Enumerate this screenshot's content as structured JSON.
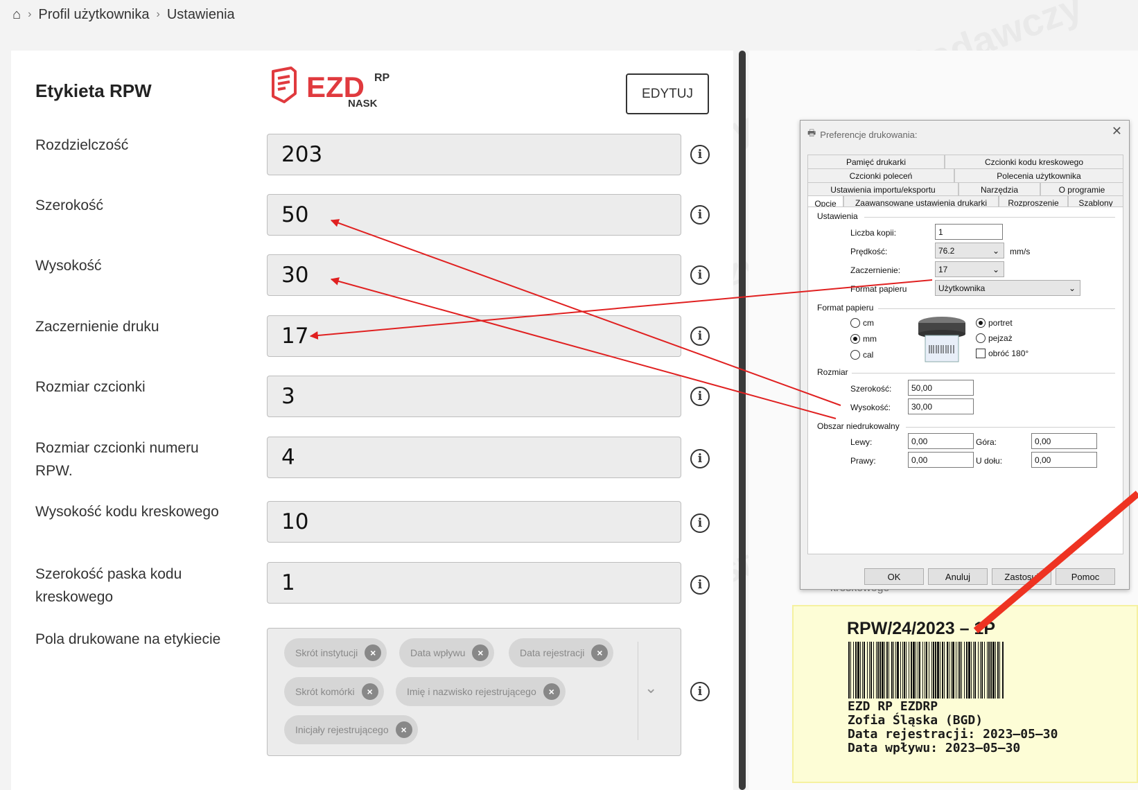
{
  "breadcrumb": {
    "level1": "Profil użytkownika",
    "level2": "Ustawienia"
  },
  "panel": {
    "title": "Etykieta RPW",
    "edit_label": "EDYTUJ"
  },
  "logo": {
    "text": "EZD",
    "sup": "RP",
    "sub": "NASK",
    "color": "#e03a3e"
  },
  "watermark": {
    "text": "NASK – Państwowy Instytut Badawczy"
  },
  "fields": [
    {
      "label": "Rozdzielczość",
      "value": "203"
    },
    {
      "label": "Szerokość",
      "value": "50"
    },
    {
      "label": "Wysokość",
      "value": "30"
    },
    {
      "label": "Zaczernienie druku",
      "value": "17"
    },
    {
      "label": "Rozmiar czcionki",
      "value": "3"
    },
    {
      "label": "Rozmiar czcionki numeru RPW.",
      "value": "4"
    },
    {
      "label": "Wysokość kodu kreskowego",
      "value": "10"
    },
    {
      "label": "Szerokość paska kodu kreskowego",
      "value": "1"
    }
  ],
  "printed_fields": {
    "label": "Pola drukowane na etykiecie",
    "tags": [
      "Skrót instytucji",
      "Data wpływu",
      "Data rejestracji",
      "Skrót komórki",
      "Imię i nazwisko rejestrującego",
      "Inicjały rejestrującego"
    ]
  },
  "dialog": {
    "title": "Preferencje drukowania:",
    "tabs_row1": [
      "Pamięć drukarki",
      "Czcionki kodu kreskowego"
    ],
    "tabs_row2": [
      "Czcionki poleceń",
      "Polecenia użytkownika"
    ],
    "tabs_row3": [
      "Ustawienia importu/eksportu",
      "Narzędzia",
      "O programie"
    ],
    "tabs_row4": [
      "Opcje",
      "Zaawansowane ustawienia drukarki",
      "Rozproszenie",
      "Szablony"
    ],
    "group_settings": "Ustawienia",
    "copies_label": "Liczba kopii:",
    "copies_value": "1",
    "speed_label": "Prędkość:",
    "speed_value": "76.2",
    "speed_unit": "mm/s",
    "darkness_label": "Zaczernienie:",
    "darkness_value": "17",
    "paper_label": "Format papieru",
    "paper_value": "Użytkownika",
    "group_paper": "Format papieru",
    "unit_cm": "cm",
    "unit_mm": "mm",
    "unit_cal": "cal",
    "orient_portrait": "portret",
    "orient_landscape": "pejzaż",
    "rotate": "obróć 180°",
    "group_size": "Rozmiar",
    "width_label": "Szerokość:",
    "width_value": "50,00",
    "height_label": "Wysokość:",
    "height_value": "30,00",
    "group_margin": "Obszar niedrukowalny",
    "left_label": "Lewy:",
    "left_value": "0,00",
    "top_label": "Góra:",
    "top_value": "0,00",
    "right_label": "Prawy:",
    "right_value": "0,00",
    "bottom_label": "U dołu:",
    "bottom_value": "0,00",
    "btn_ok": "OK",
    "btn_cancel": "Anuluj",
    "btn_apply": "Zastosuj",
    "btn_help": "Pomoc"
  },
  "preview": {
    "truncated_text": "kreskowego",
    "rpw": "RPW/24/2023 – 1P",
    "line1": "EZD RP EZDRP",
    "line2": "Zofia Śląska (BGD)",
    "line3": "Data rejestracji: 2023–05–30",
    "line4": "Data wpływu: 2023–05–30"
  },
  "colors": {
    "arrow": "#e02020",
    "arrow_big": "#ee3322"
  }
}
